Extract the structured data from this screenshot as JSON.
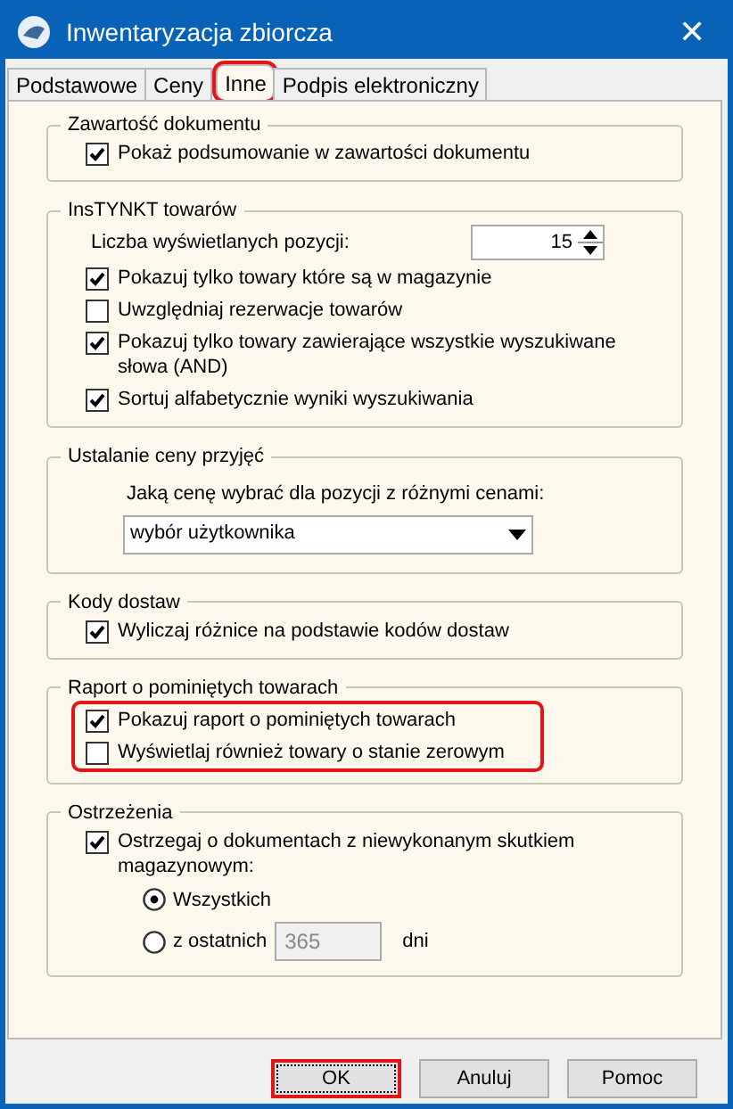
{
  "window": {
    "title": "Inwentaryzacja zbiorcza",
    "close": "✕"
  },
  "tabs": [
    {
      "label": "Podstawowe",
      "selected": false,
      "highlighted": false
    },
    {
      "label": "Ceny",
      "selected": false,
      "highlighted": false
    },
    {
      "label": "Inne",
      "selected": true,
      "highlighted": true
    },
    {
      "label": "Podpis elektroniczny",
      "selected": false,
      "highlighted": false
    }
  ],
  "groups": [
    {
      "title": "Zawartość dokumentu",
      "items": [
        {
          "kind": "checkbox",
          "label": "Pokaż podsumowanie w zawartości dokumentu",
          "checked": true,
          "highlighted": false
        }
      ]
    },
    {
      "title": "InsTYNKT towarów",
      "items": [
        {
          "kind": "spinner",
          "label": "Liczba wyświetlanych pozycji:",
          "value": "15",
          "highlighted": false
        },
        {
          "kind": "checkbox",
          "label": "Pokazuj tylko towary które są w magazynie",
          "checked": true,
          "highlighted": false
        },
        {
          "kind": "checkbox",
          "label": "Uwzględniaj rezerwacje towarów",
          "checked": false,
          "highlighted": false
        },
        {
          "kind": "checkbox",
          "label": "Pokazuj tylko towary zawierające wszystkie wyszukiwane słowa (AND)",
          "checked": true,
          "highlighted": false
        },
        {
          "kind": "checkbox",
          "label": "Sortuj alfabetycznie wyniki wyszukiwania",
          "checked": true,
          "highlighted": false
        }
      ]
    },
    {
      "title": "Ustalanie ceny przyjęć",
      "items": [
        {
          "kind": "label",
          "label": "Jaką cenę wybrać dla pozycji z różnymi cenami:",
          "highlighted": false
        },
        {
          "kind": "dropdown",
          "value": "wybór użytkownika",
          "highlighted": false
        }
      ]
    },
    {
      "title": "Kody dostaw",
      "items": [
        {
          "kind": "checkbox",
          "label": "Wyliczaj różnice na podstawie kodów dostaw",
          "checked": true,
          "highlighted": false
        }
      ]
    },
    {
      "title": "Raport o pominiętych towarach",
      "items": [
        {
          "kind": "checkbox",
          "label": "Pokazuj raport o pominiętych towarach",
          "checked": true,
          "highlighted": true
        },
        {
          "kind": "checkbox",
          "label": "Wyświetlaj również towary o stanie zerowym",
          "checked": false,
          "highlighted": true
        }
      ]
    },
    {
      "title": "Ostrzeżenia",
      "items": [
        {
          "kind": "checkbox",
          "label": "Ostrzegaj o dokumentach z niewykonanym skutkiem magazynowym:",
          "checked": true,
          "highlighted": false
        },
        {
          "kind": "radio",
          "label": "Wszystkich",
          "selected": true,
          "highlighted": false
        },
        {
          "kind": "radio",
          "label": "z ostatnich",
          "selected": false,
          "highlighted": false,
          "field": {
            "value": "365",
            "disabled": true
          },
          "suffix": "dni"
        }
      ]
    }
  ],
  "buttons": [
    {
      "label": "OK",
      "default": true,
      "highlighted": true
    },
    {
      "label": "Anuluj",
      "default": false,
      "highlighted": false
    },
    {
      "label": "Pomoc",
      "default": false,
      "highlighted": false
    }
  ]
}
